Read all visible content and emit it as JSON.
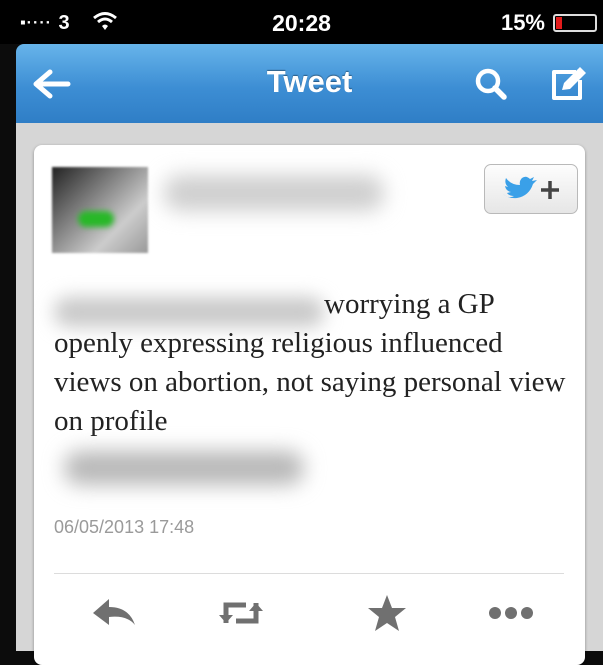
{
  "status_bar": {
    "carrier": "3",
    "time": "20:28",
    "battery": "15%",
    "battery_level": 0.15
  },
  "nav": {
    "title": "Tweet",
    "back_icon": "back-arrow-icon",
    "search_icon": "search-icon",
    "compose_icon": "compose-icon"
  },
  "tweet": {
    "text": "worrying a GP openly expressing religious influenced views on abortion, not saying personal view on profile",
    "timestamp": "06/05/2013 17:48"
  },
  "actions": {
    "reply_icon": "reply-icon",
    "retweet_icon": "retweet-icon",
    "favorite_icon": "star-icon",
    "more_icon": "more-icon"
  },
  "colors": {
    "nav_blue": "#3d8ed4",
    "twitter_bird": "#3aa0e8",
    "battery_red": "#e31b1b"
  }
}
